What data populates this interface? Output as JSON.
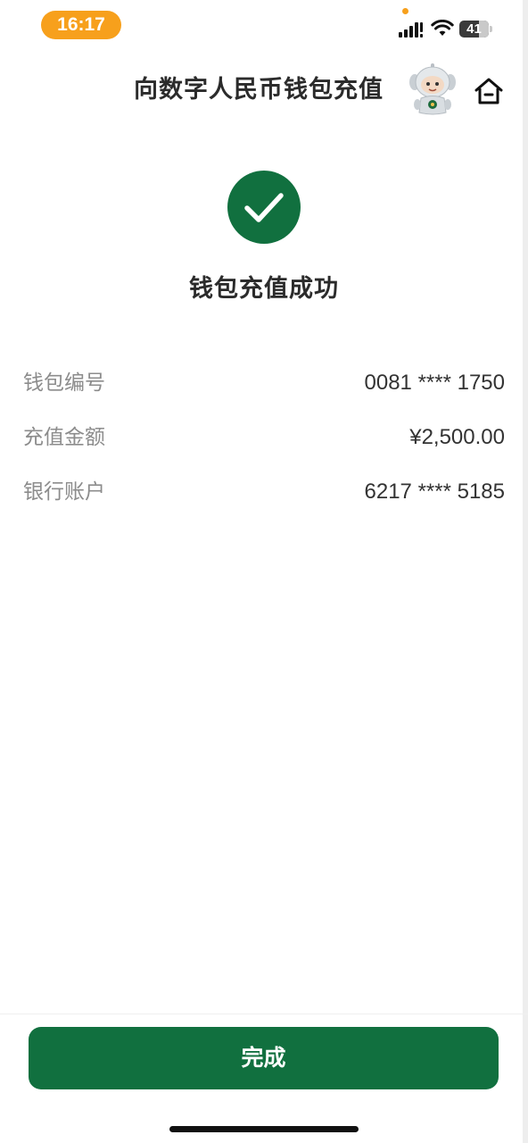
{
  "status_bar": {
    "time": "16:17",
    "battery": "41",
    "icons": [
      "signal-icon",
      "wifi-icon",
      "battery-icon"
    ]
  },
  "header": {
    "title": "向数字人民币钱包充值",
    "icons": [
      "robot-assistant-avatar",
      "home-icon"
    ]
  },
  "result": {
    "title": "钱包充值成功",
    "icon": "check-circle-icon"
  },
  "details": [
    {
      "label": "钱包编号",
      "value": "0081 **** 1750"
    },
    {
      "label": "充值金额",
      "value": "¥2,500.00"
    },
    {
      "label": "银行账户",
      "value": "6217 **** 5185"
    }
  ],
  "footer": {
    "done_label": "完成"
  },
  "colors": {
    "primary_green": "#11703f",
    "time_pill": "#f7a01c",
    "label_gray": "#8c8c8c",
    "text_dark": "#2b2b2b"
  }
}
